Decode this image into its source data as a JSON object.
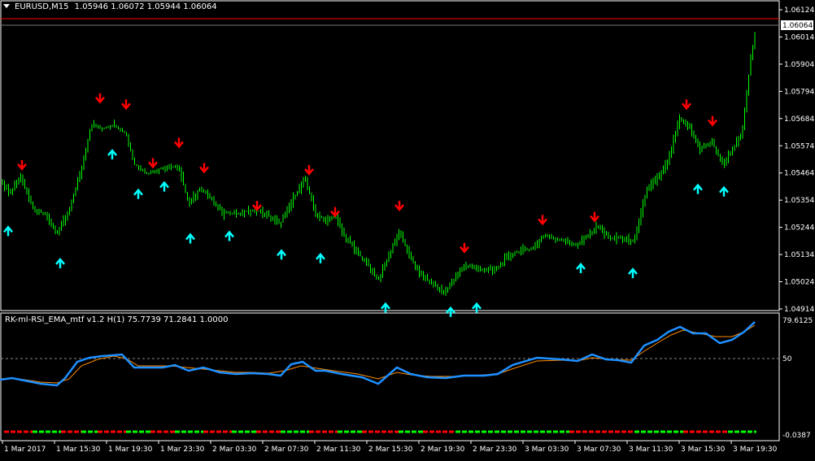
{
  "main": {
    "header": {
      "symbol": "EURUSD,M15",
      "ohlc": "1.05946 1.06072 1.05944 1.06064"
    },
    "price_axis": [
      "1.06124",
      "1.06014",
      "1.05904",
      "1.05794",
      "1.05684",
      "1.05574",
      "1.05464",
      "1.05354",
      "1.05244",
      "1.05134",
      "1.05024",
      "1.04914"
    ],
    "current_price": "1.06064",
    "colors": {
      "candle": "#00ff00",
      "arrow_up": "#00ffff",
      "arrow_down": "#ff0000",
      "bg": "#000000",
      "grid": "#ffffff"
    }
  },
  "indicator": {
    "header": "RK-ml-RSI_EMA_mtf v1.2 H(1) 75.7739 71.2841 1.0000",
    "axis": {
      "top": "79.6125",
      "mid": "50",
      "bottom": "-0.0387"
    },
    "colors": {
      "rsi": "#1e90ff",
      "ema": "#ff8c00",
      "level": "#ffffff"
    }
  },
  "time_axis": [
    "1 Mar 2017",
    "1 Mar 15:30",
    "1 Mar 19:30",
    "1 Mar 23:30",
    "2 Mar 03:30",
    "2 Mar 07:30",
    "2 Mar 11:30",
    "2 Mar 15:30",
    "2 Mar 19:30",
    "2 Mar 23:30",
    "3 Mar 03:30",
    "3 Mar 07:30",
    "3 Mar 11:30",
    "3 Mar 15:30",
    "3 Mar 19:30"
  ],
  "chart_data": {
    "type": "line",
    "title": "EURUSD,M15",
    "price_series": [
      [
        0,
        1.0544
      ],
      [
        12,
        1.0538
      ],
      [
        25,
        1.0545
      ],
      [
        40,
        1.0532
      ],
      [
        55,
        1.053
      ],
      [
        70,
        1.0522
      ],
      [
        85,
        1.0531
      ],
      [
        100,
        1.0548
      ],
      [
        112,
        1.0566
      ],
      [
        125,
        1.0564
      ],
      [
        140,
        1.0566
      ],
      [
        155,
        1.0562
      ],
      [
        165,
        1.055
      ],
      [
        180,
        1.0546
      ],
      [
        195,
        1.0548
      ],
      [
        210,
        1.0549
      ],
      [
        220,
        1.0548
      ],
      [
        232,
        1.0534
      ],
      [
        245,
        1.054
      ],
      [
        260,
        1.0536
      ],
      [
        275,
        1.053
      ],
      [
        290,
        1.053
      ],
      [
        305,
        1.0531
      ],
      [
        318,
        1.0531
      ],
      [
        330,
        1.0529
      ],
      [
        345,
        1.0526
      ],
      [
        360,
        1.0536
      ],
      [
        375,
        1.0544
      ],
      [
        388,
        1.053
      ],
      [
        400,
        1.0527
      ],
      [
        412,
        1.0529
      ],
      [
        425,
        1.052
      ],
      [
        440,
        1.0514
      ],
      [
        455,
        1.0508
      ],
      [
        465,
        1.0503
      ],
      [
        478,
        1.0513
      ],
      [
        490,
        1.0523
      ],
      [
        502,
        1.0514
      ],
      [
        515,
        1.0506
      ],
      [
        530,
        1.0502
      ],
      [
        545,
        1.0498
      ],
      [
        558,
        1.0503
      ],
      [
        570,
        1.0509
      ],
      [
        585,
        1.0508
      ],
      [
        600,
        1.0507
      ],
      [
        612,
        1.0508
      ],
      [
        625,
        1.0513
      ],
      [
        640,
        1.0515
      ],
      [
        655,
        1.0516
      ],
      [
        668,
        1.0521
      ],
      [
        680,
        1.052
      ],
      [
        695,
        1.0519
      ],
      [
        710,
        1.0517
      ],
      [
        722,
        1.0521
      ],
      [
        735,
        1.0525
      ],
      [
        750,
        1.052
      ],
      [
        765,
        1.052
      ],
      [
        780,
        1.0519
      ],
      [
        795,
        1.054
      ],
      [
        810,
        1.0545
      ],
      [
        822,
        1.0552
      ],
      [
        835,
        1.0568
      ],
      [
        848,
        1.0565
      ],
      [
        860,
        1.0556
      ],
      [
        875,
        1.0559
      ],
      [
        888,
        1.055
      ],
      [
        900,
        1.0556
      ],
      [
        912,
        1.0562
      ],
      [
        922,
        1.059
      ],
      [
        930,
        1.06064
      ]
    ],
    "arrows_down": [
      [
        27,
        1.0549
      ],
      [
        123,
        1.0576
      ],
      [
        155,
        1.05735
      ],
      [
        188,
        1.05498
      ],
      [
        220,
        1.0558
      ],
      [
        251,
        1.05478
      ],
      [
        316,
        1.05325
      ],
      [
        380,
        1.0547
      ],
      [
        412,
        1.053
      ],
      [
        491,
        1.05325
      ],
      [
        571,
        1.05155
      ],
      [
        667,
        1.05268
      ],
      [
        731,
        1.0528
      ],
      [
        844,
        1.05735
      ],
      [
        876,
        1.05668
      ]
    ],
    "arrows_up": [
      [
        10,
        1.05235
      ],
      [
        74,
        1.05105
      ],
      [
        138,
        1.05545
      ],
      [
        170,
        1.05385
      ],
      [
        202,
        1.05415
      ],
      [
        234,
        1.05205
      ],
      [
        282,
        1.05215
      ],
      [
        346,
        1.0514
      ],
      [
        394,
        1.05125
      ],
      [
        474,
        1.04925
      ],
      [
        554,
        1.04908
      ],
      [
        586,
        1.04925
      ],
      [
        714,
        1.05085
      ],
      [
        778,
        1.05065
      ],
      [
        858,
        1.05405
      ],
      [
        890,
        1.05395
      ]
    ],
    "rsi": [
      [
        0,
        467
      ],
      [
        15,
        465
      ],
      [
        30,
        468
      ],
      [
        50,
        472
      ],
      [
        70,
        474
      ],
      [
        80,
        465
      ],
      [
        95,
        445
      ],
      [
        110,
        440
      ],
      [
        125,
        438
      ],
      [
        150,
        436
      ],
      [
        165,
        452
      ],
      [
        185,
        452
      ],
      [
        200,
        452
      ],
      [
        215,
        449
      ],
      [
        232,
        456
      ],
      [
        250,
        452
      ],
      [
        270,
        458
      ],
      [
        290,
        460
      ],
      [
        310,
        459
      ],
      [
        330,
        460
      ],
      [
        345,
        462
      ],
      [
        358,
        448
      ],
      [
        372,
        445
      ],
      [
        388,
        456
      ],
      [
        400,
        456
      ],
      [
        420,
        460
      ],
      [
        445,
        464
      ],
      [
        465,
        472
      ],
      [
        488,
        452
      ],
      [
        505,
        460
      ],
      [
        525,
        464
      ],
      [
        548,
        465
      ],
      [
        570,
        462
      ],
      [
        595,
        462
      ],
      [
        612,
        460
      ],
      [
        630,
        449
      ],
      [
        660,
        440
      ],
      [
        690,
        442
      ],
      [
        710,
        444
      ],
      [
        728,
        436
      ],
      [
        745,
        442
      ],
      [
        760,
        443
      ],
      [
        776,
        446
      ],
      [
        792,
        425
      ],
      [
        808,
        418
      ],
      [
        822,
        408
      ],
      [
        836,
        402
      ],
      [
        852,
        410
      ],
      [
        868,
        410
      ],
      [
        885,
        422
      ],
      [
        900,
        418
      ],
      [
        915,
        408
      ],
      [
        928,
        396
      ]
    ],
    "ema": [
      [
        0,
        466
      ],
      [
        15,
        465
      ],
      [
        30,
        467
      ],
      [
        50,
        470
      ],
      [
        70,
        471
      ],
      [
        85,
        466
      ],
      [
        100,
        450
      ],
      [
        120,
        442
      ],
      [
        140,
        438
      ],
      [
        155,
        441
      ],
      [
        170,
        450
      ],
      [
        190,
        450
      ],
      [
        210,
        450
      ],
      [
        230,
        452
      ],
      [
        250,
        454
      ],
      [
        270,
        456
      ],
      [
        290,
        458
      ],
      [
        310,
        458
      ],
      [
        330,
        459
      ],
      [
        350,
        456
      ],
      [
        370,
        450
      ],
      [
        390,
        453
      ],
      [
        410,
        456
      ],
      [
        440,
        460
      ],
      [
        465,
        466
      ],
      [
        488,
        458
      ],
      [
        505,
        461
      ],
      [
        530,
        463
      ],
      [
        555,
        463
      ],
      [
        580,
        462
      ],
      [
        612,
        460
      ],
      [
        635,
        452
      ],
      [
        660,
        444
      ],
      [
        690,
        443
      ],
      [
        710,
        444
      ],
      [
        728,
        440
      ],
      [
        750,
        442
      ],
      [
        776,
        443
      ],
      [
        792,
        432
      ],
      [
        808,
        422
      ],
      [
        825,
        412
      ],
      [
        840,
        406
      ],
      [
        860,
        410
      ],
      [
        880,
        414
      ],
      [
        900,
        414
      ],
      [
        915,
        408
      ],
      [
        928,
        400
      ]
    ],
    "bottom_markers_green": [
      [
        40,
        75
      ],
      [
        100,
        120
      ],
      [
        155,
        185
      ],
      [
        215,
        250
      ],
      [
        285,
        315
      ],
      [
        345,
        380
      ],
      [
        415,
        445
      ],
      [
        490,
        520
      ],
      [
        560,
        700
      ],
      [
        780,
        840
      ],
      [
        895,
        930
      ]
    ],
    "bottom_markers_red": [
      [
        5,
        40
      ],
      [
        75,
        100
      ],
      [
        120,
        155
      ],
      [
        185,
        215
      ],
      [
        250,
        285
      ],
      [
        315,
        345
      ],
      [
        380,
        415
      ],
      [
        445,
        490
      ],
      [
        520,
        560
      ],
      [
        700,
        780
      ],
      [
        840,
        895
      ]
    ],
    "price_ylim": [
      1.04914,
      1.06124
    ],
    "xlabel": "",
    "ylabel": "",
    "grid": false,
    "legend": "none"
  }
}
